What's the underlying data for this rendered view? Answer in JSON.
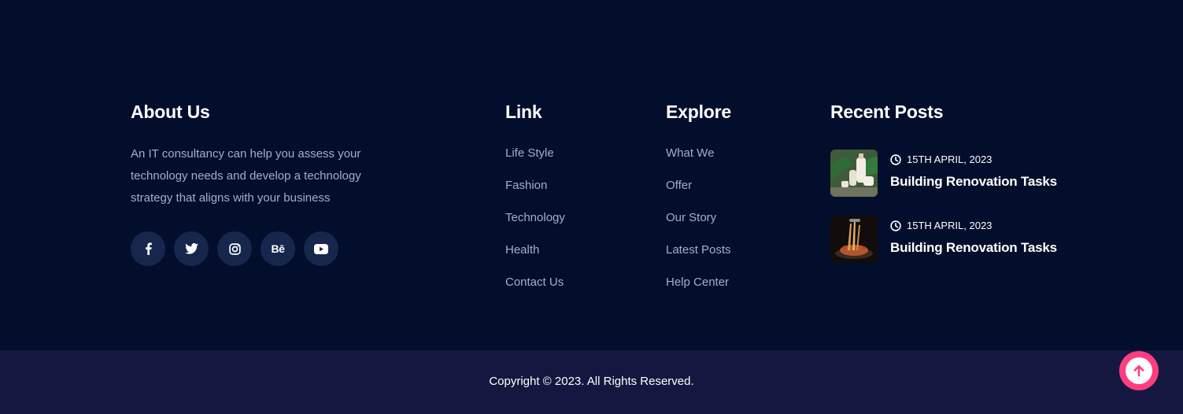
{
  "about": {
    "heading": "About Us",
    "text": "An IT consultancy can help you assess your technology needs and develop a technology strategy that aligns with your business",
    "socials": [
      {
        "icon": "facebook-icon"
      },
      {
        "icon": "twitter-icon"
      },
      {
        "icon": "instagram-icon"
      },
      {
        "icon": "behance-icon",
        "label": "Bē"
      },
      {
        "icon": "youtube-icon"
      }
    ]
  },
  "link": {
    "heading": "Link",
    "items": [
      "Life Style",
      "Fashion",
      "Technology",
      "Health",
      "Contact Us"
    ]
  },
  "explore": {
    "heading": "Explore",
    "items": [
      "What We",
      "Offer",
      "Our Story",
      "Latest Posts",
      "Help Center"
    ]
  },
  "recent": {
    "heading": "Recent Posts",
    "posts": [
      {
        "date": "15TH APRIL, 2023",
        "title": "Building Renovation Tasks"
      },
      {
        "date": "15TH APRIL, 2023",
        "title": "Building Renovation Tasks"
      }
    ]
  },
  "bottom": {
    "copyright": "Copyright © 2023. All Rights Reserved."
  },
  "colors": {
    "background": "#020e2b",
    "bottom_bar": "#141840",
    "social_button": "#16264d",
    "accent": "#ff3d7f",
    "muted_text": "#a6aec4"
  }
}
